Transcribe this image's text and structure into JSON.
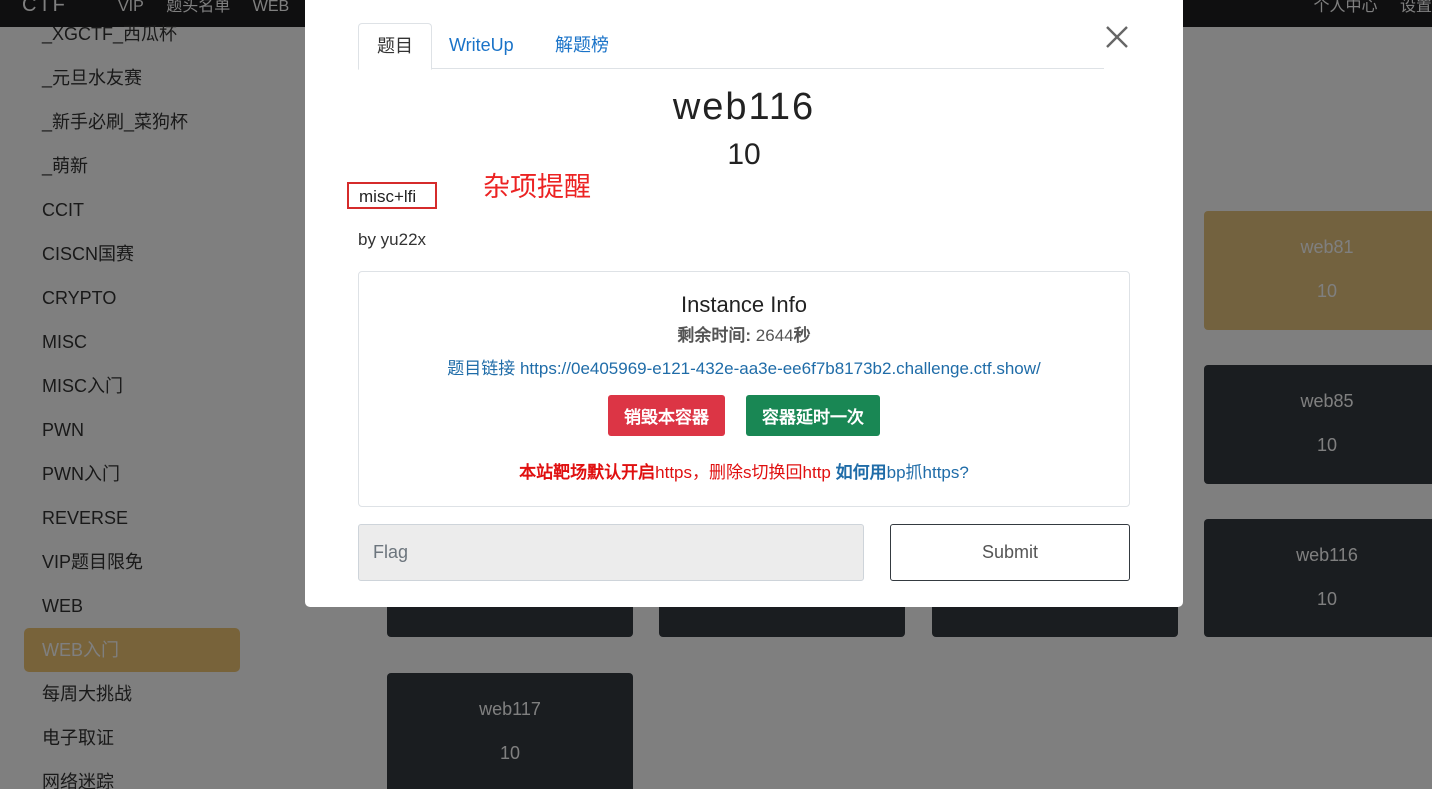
{
  "topbar": {
    "logo": "CTF",
    "nav": [
      "VIP",
      "题头名单",
      "WEB"
    ],
    "right": [
      "个人中心",
      "设置"
    ]
  },
  "sidebar": {
    "items": [
      {
        "label": "_XGCTF_西瓜杯",
        "active": false
      },
      {
        "label": "_元旦水友赛",
        "active": false
      },
      {
        "label": "_新手必刷_菜狗杯",
        "active": false
      },
      {
        "label": "_萌新",
        "active": false
      },
      {
        "label": "CCIT",
        "active": false
      },
      {
        "label": "CISCN国赛",
        "active": false
      },
      {
        "label": "CRYPTO",
        "active": false
      },
      {
        "label": "MISC",
        "active": false
      },
      {
        "label": "MISC入门",
        "active": false
      },
      {
        "label": "PWN",
        "active": false
      },
      {
        "label": "PWN入门",
        "active": false
      },
      {
        "label": "REVERSE",
        "active": false
      },
      {
        "label": "VIP题目限免",
        "active": false
      },
      {
        "label": "WEB",
        "active": false
      },
      {
        "label": "WEB入门",
        "active": true
      },
      {
        "label": "每周大挑战",
        "active": false
      },
      {
        "label": "电子取证",
        "active": false
      },
      {
        "label": "网络迷踪",
        "active": false
      }
    ]
  },
  "cards": [
    {
      "name": "web81",
      "score": "10",
      "solved": true
    },
    {
      "name": "web85",
      "score": "10",
      "solved": false
    },
    {
      "name": "web116",
      "score": "10",
      "solved": false
    },
    {
      "name": "web117",
      "score": "10",
      "solved": false
    }
  ],
  "modal": {
    "tabs": [
      "题目",
      "WriteUp",
      "解题榜"
    ],
    "active_tab": "题目",
    "title": "web116",
    "score": "10",
    "tag": "misc+lfi",
    "annotation": "杂项提醒",
    "author": "by yu22x",
    "instance": {
      "title": "Instance Info",
      "time_label": "剩余时间:",
      "time_value": "2644",
      "time_unit": "秒",
      "link_label": "题目链接",
      "link_url": "https://0e405969-e121-432e-aa3e-ee6f7b8173b2.challenge.ctf.show/",
      "destroy_button": "销毁本容器",
      "extend_button": "容器延时一次",
      "note_part1": "本站靶场默认开启",
      "note_part2": "https，删除s切换回",
      "note_part3": "http",
      "help_part1": "如何用",
      "help_part2": "bp抓https?"
    },
    "flag_placeholder": "Flag",
    "submit_label": "Submit"
  },
  "colors": {
    "accent_active": "#f0c674",
    "card_dark": "#343a40",
    "danger": "#dc3545",
    "success": "#198754",
    "link": "#1f6ca8",
    "annotation_red": "#ec2323"
  }
}
